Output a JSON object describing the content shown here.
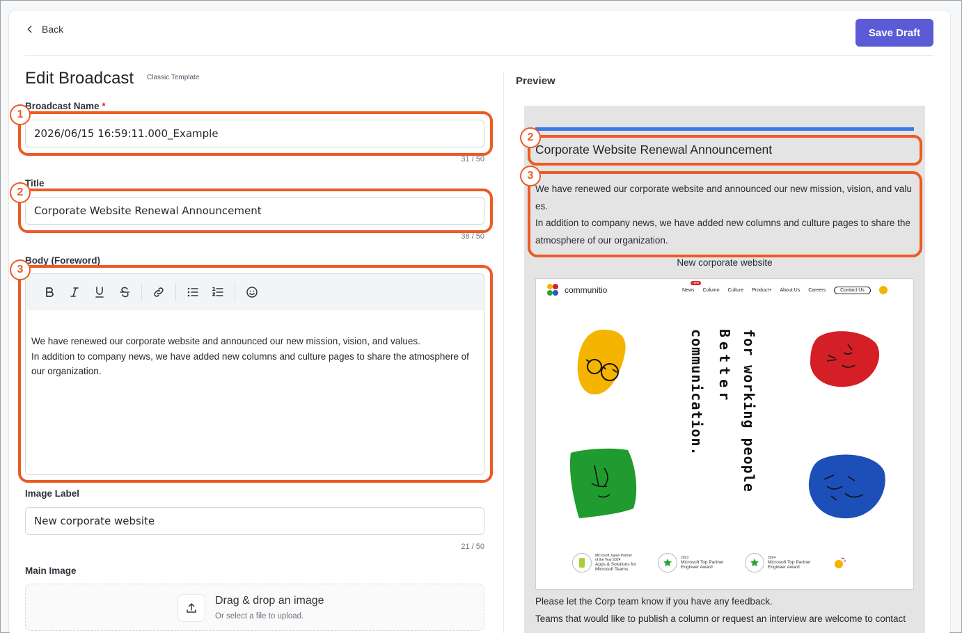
{
  "header": {
    "back_label": "Back",
    "save_label": "Save Draft"
  },
  "form": {
    "page_title": "Edit Broadcast",
    "template_tag": "Classic Template",
    "broadcast_name": {
      "label": "Broadcast Name",
      "required_mark": "*",
      "value": "2026/06/15 16:59:11.000_Example",
      "counter": "31 / 50"
    },
    "title": {
      "label": "Title",
      "value": "Corporate Website Renewal Announcement",
      "counter": "38 / 50"
    },
    "body": {
      "label": "Body (Foreword)",
      "toolbar": [
        "bold",
        "italic",
        "underline",
        "strikethrough",
        "link",
        "bullet-list",
        "numbered-list",
        "emoji"
      ],
      "line1": "We have renewed our corporate website and announced our new mission, vision, and values.",
      "line2": "In addition to company news, we have added new columns and culture pages to share the atmosphere of our organization."
    },
    "image_label": {
      "label": "Image Label",
      "value": "New corporate website",
      "counter": "21 / 50"
    },
    "main_image": {
      "label": "Main Image",
      "drop_title": "Drag & drop an image",
      "drop_sub": "Or select a file to upload."
    }
  },
  "preview": {
    "label": "Preview",
    "title": "Corporate Website Renewal Announcement",
    "body_line1": "We have renewed our corporate website and announced our new mission, vision, and values.",
    "body_line2": "In addition to company news, we have added new columns and culture pages to share the atmosphere of our organization.",
    "image_label": "New corporate website",
    "footer_line1": "Please let the Corp team know if you have any feedback.",
    "footer_line2": "Teams that would like to publish a column or request an interview are welcome to contact us."
  },
  "site_image": {
    "logo": "communitio",
    "nav": [
      "News",
      "Column",
      "Culture",
      "Product+",
      "About Us",
      "Careers"
    ],
    "new_badge": "new",
    "contact": "Contact Us",
    "tagline_col1": "for working people",
    "tagline_col2": "Better",
    "tagline_col3": "communication.",
    "award1_top": "Microsoft Japan Partner",
    "award1_mid": "of the Year 2024",
    "award1_bottom": "Apps & Solutions for Microsoft Teams",
    "award2_year": "2023",
    "award2_text": "Microsoft Top Partner Engineer Award",
    "award3_year": "2024",
    "award3_text": "Microsoft Top Partner Engineer Award"
  },
  "annotations": {
    "n1": "1",
    "n2": "2",
    "n3": "3"
  },
  "colors": {
    "accent": "#5b5bd6",
    "highlight": "#ec5b24",
    "preview_bar": "#3b78e7"
  }
}
